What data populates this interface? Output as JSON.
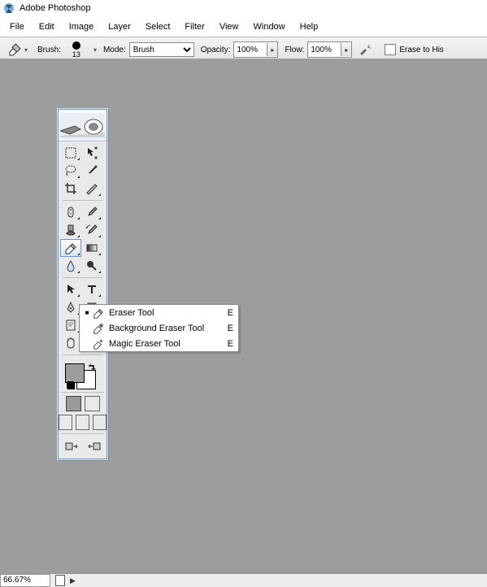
{
  "app_title": "Adobe Photoshop",
  "menus": {
    "file": "File",
    "edit": "Edit",
    "image": "Image",
    "layer": "Layer",
    "select": "Select",
    "filter": "Filter",
    "view": "View",
    "window": "Window",
    "help": "Help"
  },
  "options": {
    "brush_label": "Brush:",
    "brush_size": "13",
    "mode_label": "Mode:",
    "mode_value": "Brush",
    "opacity_label": "Opacity:",
    "opacity_value": "100%",
    "flow_label": "Flow:",
    "flow_value": "100%",
    "erase_to_history": "Erase to His"
  },
  "eraser_menu": {
    "items": [
      {
        "label": "Eraser Tool",
        "key": "E",
        "icon": "eraser-icon",
        "selected": true
      },
      {
        "label": "Background Eraser Tool",
        "key": "E",
        "icon": "bg-eraser-icon",
        "selected": false
      },
      {
        "label": "Magic Eraser Tool",
        "key": "E",
        "icon": "magic-eraser-icon",
        "selected": false
      }
    ]
  },
  "status": {
    "zoom": "66.67%"
  },
  "colors": {
    "canvas_bg": "#9d9d9d",
    "toolbox_border": "#6a99c8"
  }
}
